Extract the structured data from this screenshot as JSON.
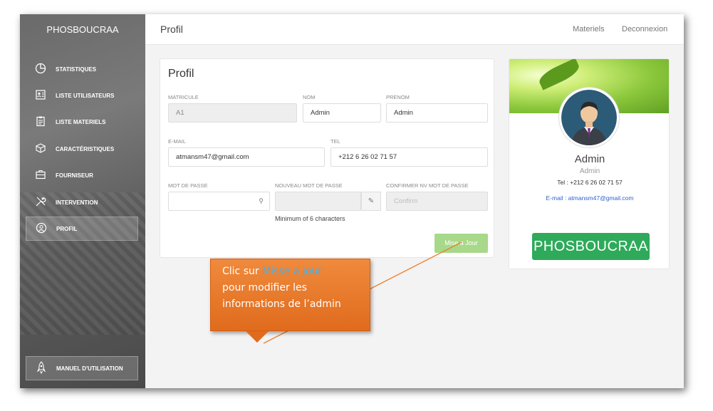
{
  "sidebar": {
    "brand": "PHOSBOUCRAA",
    "items": [
      {
        "label": "STATISTIQUES",
        "icon": "pie-chart-icon"
      },
      {
        "label": "LISTE UTILISATEURS",
        "icon": "users-list-icon"
      },
      {
        "label": "LISTE MATERIELS",
        "icon": "clipboard-icon"
      },
      {
        "label": "CARACTÉRISTIQUES",
        "icon": "box-icon"
      },
      {
        "label": "FOURNISEUR",
        "icon": "briefcase-icon"
      },
      {
        "label": "INTERVENTION",
        "icon": "tools-icon"
      },
      {
        "label": "PROFIL",
        "icon": "user-icon"
      }
    ],
    "active_item": "PROFIL",
    "manual": "MANUEL D'UTILISATION"
  },
  "topbar": {
    "title": "Profil",
    "links": [
      "Materiels",
      "Deconnexion"
    ]
  },
  "form": {
    "title": "Profil",
    "matricule": {
      "label": "MATRICULE",
      "value": "A1"
    },
    "nom": {
      "label": "NOM",
      "value": "Admin"
    },
    "prenom": {
      "label": "PRENOM",
      "value": "Admin"
    },
    "email": {
      "label": "E-MAIL",
      "value": "atmansm47@gmail.com"
    },
    "tel": {
      "label": "TEL",
      "value": "+212 6 26 02 71 57"
    },
    "password": {
      "label": "MOT DE PASSE",
      "value": ""
    },
    "new_password": {
      "label": "NOUVEAU MOT DE PASSE",
      "value": ""
    },
    "confirm_password": {
      "label": "CONFIRMER NV MOT DE PASSE",
      "placeholder": "Confirm"
    },
    "hint": "Minimum of 6 characters",
    "update_button": "Mise a Jour"
  },
  "profile_card": {
    "name": "Admin",
    "role": "Admin",
    "tel": "Tel : +212 6 26 02 71 57",
    "email": "E-mail : atmansm47@gmail.com",
    "brand": "PHOSBOUCRAA"
  },
  "annotation": {
    "prefix": "Clic sur ",
    "highlight": "Misse a jour",
    "line2": "pour modifier les",
    "line3": "informations de l’admin"
  },
  "colors": {
    "accent_green": "#2eaa5a",
    "button_green": "#a8d98a",
    "callout_orange": "#e06b1d",
    "callout_highlight": "#33b5ff",
    "email_blue": "#2f5fd0"
  }
}
